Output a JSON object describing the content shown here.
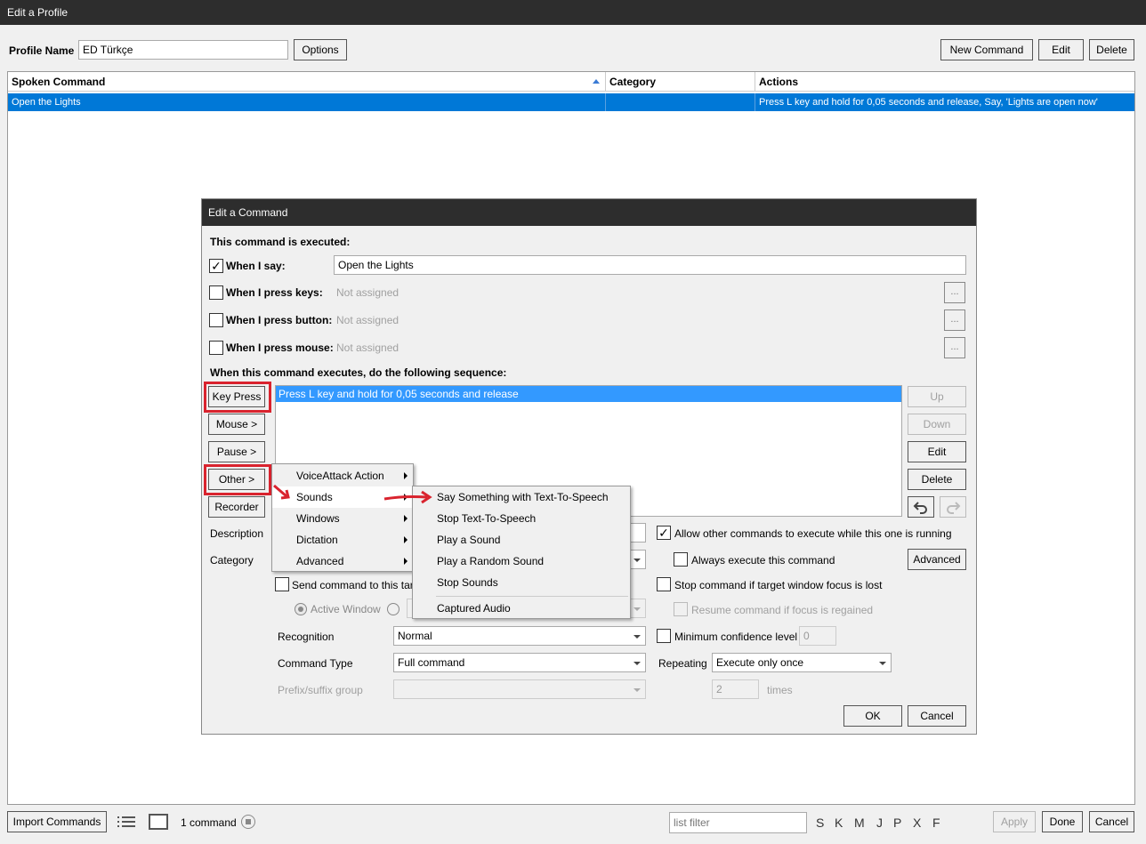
{
  "window": {
    "title": "Edit a Profile"
  },
  "profile": {
    "name_label": "Profile Name",
    "name_value": "ED Türkçe",
    "options_label": "Options",
    "new_command_label": "New Command",
    "edit_label": "Edit",
    "delete_label": "Delete"
  },
  "grid": {
    "headers": [
      "Spoken Command",
      "Category",
      "Actions"
    ],
    "rows": [
      {
        "spoken": "Open the Lights",
        "category": "",
        "actions": "Press L key and hold for 0,05 seconds and release, Say, 'Lights are open now'"
      }
    ]
  },
  "dialog": {
    "title": "Edit a Command",
    "executed_label": "This command is executed:",
    "when_say_label": "When I say:",
    "when_say_checked": true,
    "when_say_value": "Open the Lights",
    "when_keys_label": "When I press keys:",
    "when_button_label": "When I press button:",
    "when_mouse_label": "When I press mouse:",
    "not_assigned": "Not assigned",
    "dots": "...",
    "sequence_label": "When this command executes, do the following sequence:",
    "left_buttons": {
      "key_press": "Key Press",
      "mouse": "Mouse >",
      "pause": "Pause >",
      "other": "Other >",
      "recorder": "Recorder"
    },
    "actions": [
      "Press L key and hold for 0,05 seconds and release"
    ],
    "right_buttons": {
      "up": "Up",
      "down": "Down",
      "edit": "Edit",
      "delete": "Delete",
      "advanced": "Advanced"
    },
    "description_label": "Description",
    "category_label": "Category",
    "allow_other_label": "Allow other commands to execute while this one is running",
    "allow_other_checked": true,
    "always_execute_label": "Always execute this command",
    "send_command_label": "Send command to this targ",
    "stop_focus_label": "Stop command if target window focus is lost",
    "active_window_label": "Active Window",
    "resume_label": "Resume command if focus is regained",
    "recognition_label": "Recognition",
    "recognition_value": "Normal",
    "min_conf_label": "Minimum confidence level",
    "min_conf_value": "0",
    "command_type_label": "Command Type",
    "command_type_value": "Full command",
    "repeating_label": "Repeating",
    "repeating_value": "Execute only once",
    "prefix_label": "Prefix/suffix group",
    "times_value": "2",
    "times_label": "times",
    "ok_label": "OK",
    "cancel_label": "Cancel"
  },
  "menus": {
    "other": [
      "VoiceAttack Action",
      "Sounds",
      "Windows",
      "Dictation",
      "Advanced"
    ],
    "sounds": [
      "Say Something with Text-To-Speech",
      "Stop Text-To-Speech",
      "Play a Sound",
      "Play a Random Sound",
      "Stop Sounds",
      "Captured Audio"
    ]
  },
  "footer": {
    "import_label": "Import Commands",
    "count_label": "1 command",
    "filter_placeholder": "list filter",
    "letters": [
      "S",
      "K",
      "M",
      "J",
      "P",
      "X",
      "F"
    ],
    "apply_label": "Apply",
    "done_label": "Done",
    "cancel_label": "Cancel"
  },
  "colors": {
    "selection": "#0078d7",
    "highlight_red": "#d9232e",
    "titlebar": "#2d2d2d"
  }
}
